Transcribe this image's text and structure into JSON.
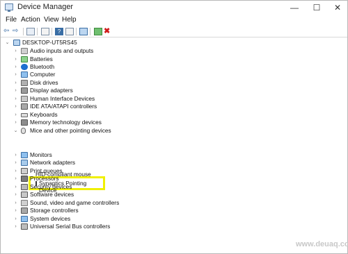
{
  "window": {
    "title": "Device Manager"
  },
  "menu": [
    "File",
    "Action",
    "View",
    "Help"
  ],
  "tree": {
    "root": "DESKTOP-UT5RS45",
    "categories": [
      "Audio inputs and outputs",
      "Batteries",
      "Bluetooth",
      "Computer",
      "Disk drives",
      "Display adapters",
      "Human Interface Devices",
      "IDE ATA/ATAPI controllers",
      "Keyboards",
      "Memory technology devices",
      "Mice and other pointing devices",
      "Monitors",
      "Network adapters",
      "Print queues",
      "Processors",
      "Security devices",
      "Software devices",
      "Sound, video and game controllers",
      "Storage controllers",
      "System devices",
      "Universal Serial Bus controllers"
    ],
    "mice_children": [
      "HID-compliant mouse",
      "Synaptics Pointing Device"
    ]
  },
  "watermark": "www.deuaq.com",
  "colors": {
    "highlight": "#f0f000",
    "accent": "#1e6fd0"
  }
}
